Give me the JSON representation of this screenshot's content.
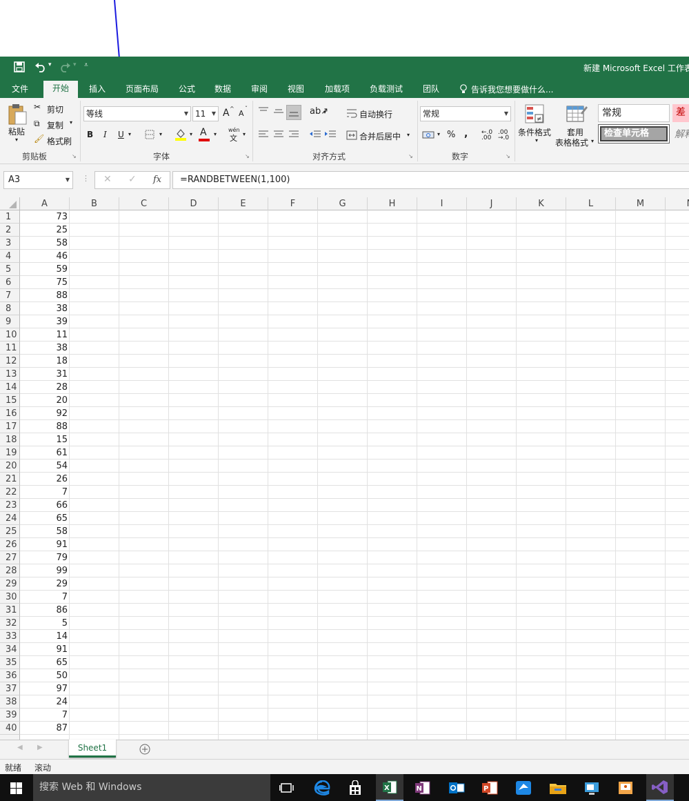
{
  "quick_access": {
    "undo_caret": "▾",
    "customize": "⩡"
  },
  "title": "新建 Microsoft Excel 工作表",
  "tabs": [
    "文件",
    "开始",
    "插入",
    "页面布局",
    "公式",
    "数据",
    "审阅",
    "视图",
    "加载项",
    "负载测试",
    "团队"
  ],
  "tell_me": "告诉我您想要做什么...",
  "ribbon": {
    "clipboard": {
      "paste": "粘贴",
      "cut": "剪切",
      "copy": "复制",
      "format_painter": "格式刷",
      "label": "剪贴板"
    },
    "font": {
      "name": "等线",
      "size": "11",
      "grow": "A",
      "shrink": "A",
      "bold": "B",
      "italic": "I",
      "underline": "U",
      "label": "字体",
      "phonetic": "wén"
    },
    "alignment": {
      "wrap": "自动换行",
      "merge": "合并后居中",
      "label": "对齐方式"
    },
    "number": {
      "format": "常规",
      "percent": "%",
      "comma": ",",
      "label": "数字"
    },
    "styles": {
      "conditional": "条件格式",
      "table": "套用",
      "table2": "表格格式",
      "style_normal": "常规",
      "style_bad": "差",
      "style_check": "检查单元格",
      "style_explain": "解释"
    }
  },
  "name_box": "A3",
  "fx": "fx",
  "formula": "=RANDBETWEEN(1,100)",
  "columns": [
    "A",
    "B",
    "C",
    "D",
    "E",
    "F",
    "G",
    "H",
    "I",
    "J",
    "K",
    "L",
    "M",
    "N"
  ],
  "rows": [
    {
      "n": "1",
      "a": "73"
    },
    {
      "n": "2",
      "a": "25"
    },
    {
      "n": "3",
      "a": "58"
    },
    {
      "n": "4",
      "a": "46"
    },
    {
      "n": "5",
      "a": "59"
    },
    {
      "n": "6",
      "a": "75"
    },
    {
      "n": "7",
      "a": "88"
    },
    {
      "n": "8",
      "a": "38"
    },
    {
      "n": "9",
      "a": "39"
    },
    {
      "n": "10",
      "a": "11"
    },
    {
      "n": "11",
      "a": "38"
    },
    {
      "n": "12",
      "a": "18"
    },
    {
      "n": "13",
      "a": "31"
    },
    {
      "n": "14",
      "a": "28"
    },
    {
      "n": "15",
      "a": "20"
    },
    {
      "n": "16",
      "a": "92"
    },
    {
      "n": "17",
      "a": "88"
    },
    {
      "n": "18",
      "a": "15"
    },
    {
      "n": "19",
      "a": "61"
    },
    {
      "n": "20",
      "a": "54"
    },
    {
      "n": "21",
      "a": "26"
    },
    {
      "n": "22",
      "a": "7"
    },
    {
      "n": "23",
      "a": "66"
    },
    {
      "n": "24",
      "a": "65"
    },
    {
      "n": "25",
      "a": "58"
    },
    {
      "n": "26",
      "a": "91"
    },
    {
      "n": "27",
      "a": "79"
    },
    {
      "n": "28",
      "a": "99"
    },
    {
      "n": "29",
      "a": "29"
    },
    {
      "n": "30",
      "a": "7"
    },
    {
      "n": "31",
      "a": "86"
    },
    {
      "n": "32",
      "a": "5"
    },
    {
      "n": "33",
      "a": "14"
    },
    {
      "n": "34",
      "a": "91"
    },
    {
      "n": "35",
      "a": "65"
    },
    {
      "n": "36",
      "a": "50"
    },
    {
      "n": "37",
      "a": "97"
    },
    {
      "n": "38",
      "a": "24"
    },
    {
      "n": "39",
      "a": "7"
    },
    {
      "n": "40",
      "a": "87"
    }
  ],
  "sheet_tab": "Sheet1",
  "status": {
    "ready": "就绪",
    "scroll": "滚动"
  },
  "taskbar": {
    "search": "搜索 Web 和 Windows"
  },
  "colors": {
    "excel_green": "#217346",
    "bad_red": "#c00000"
  }
}
